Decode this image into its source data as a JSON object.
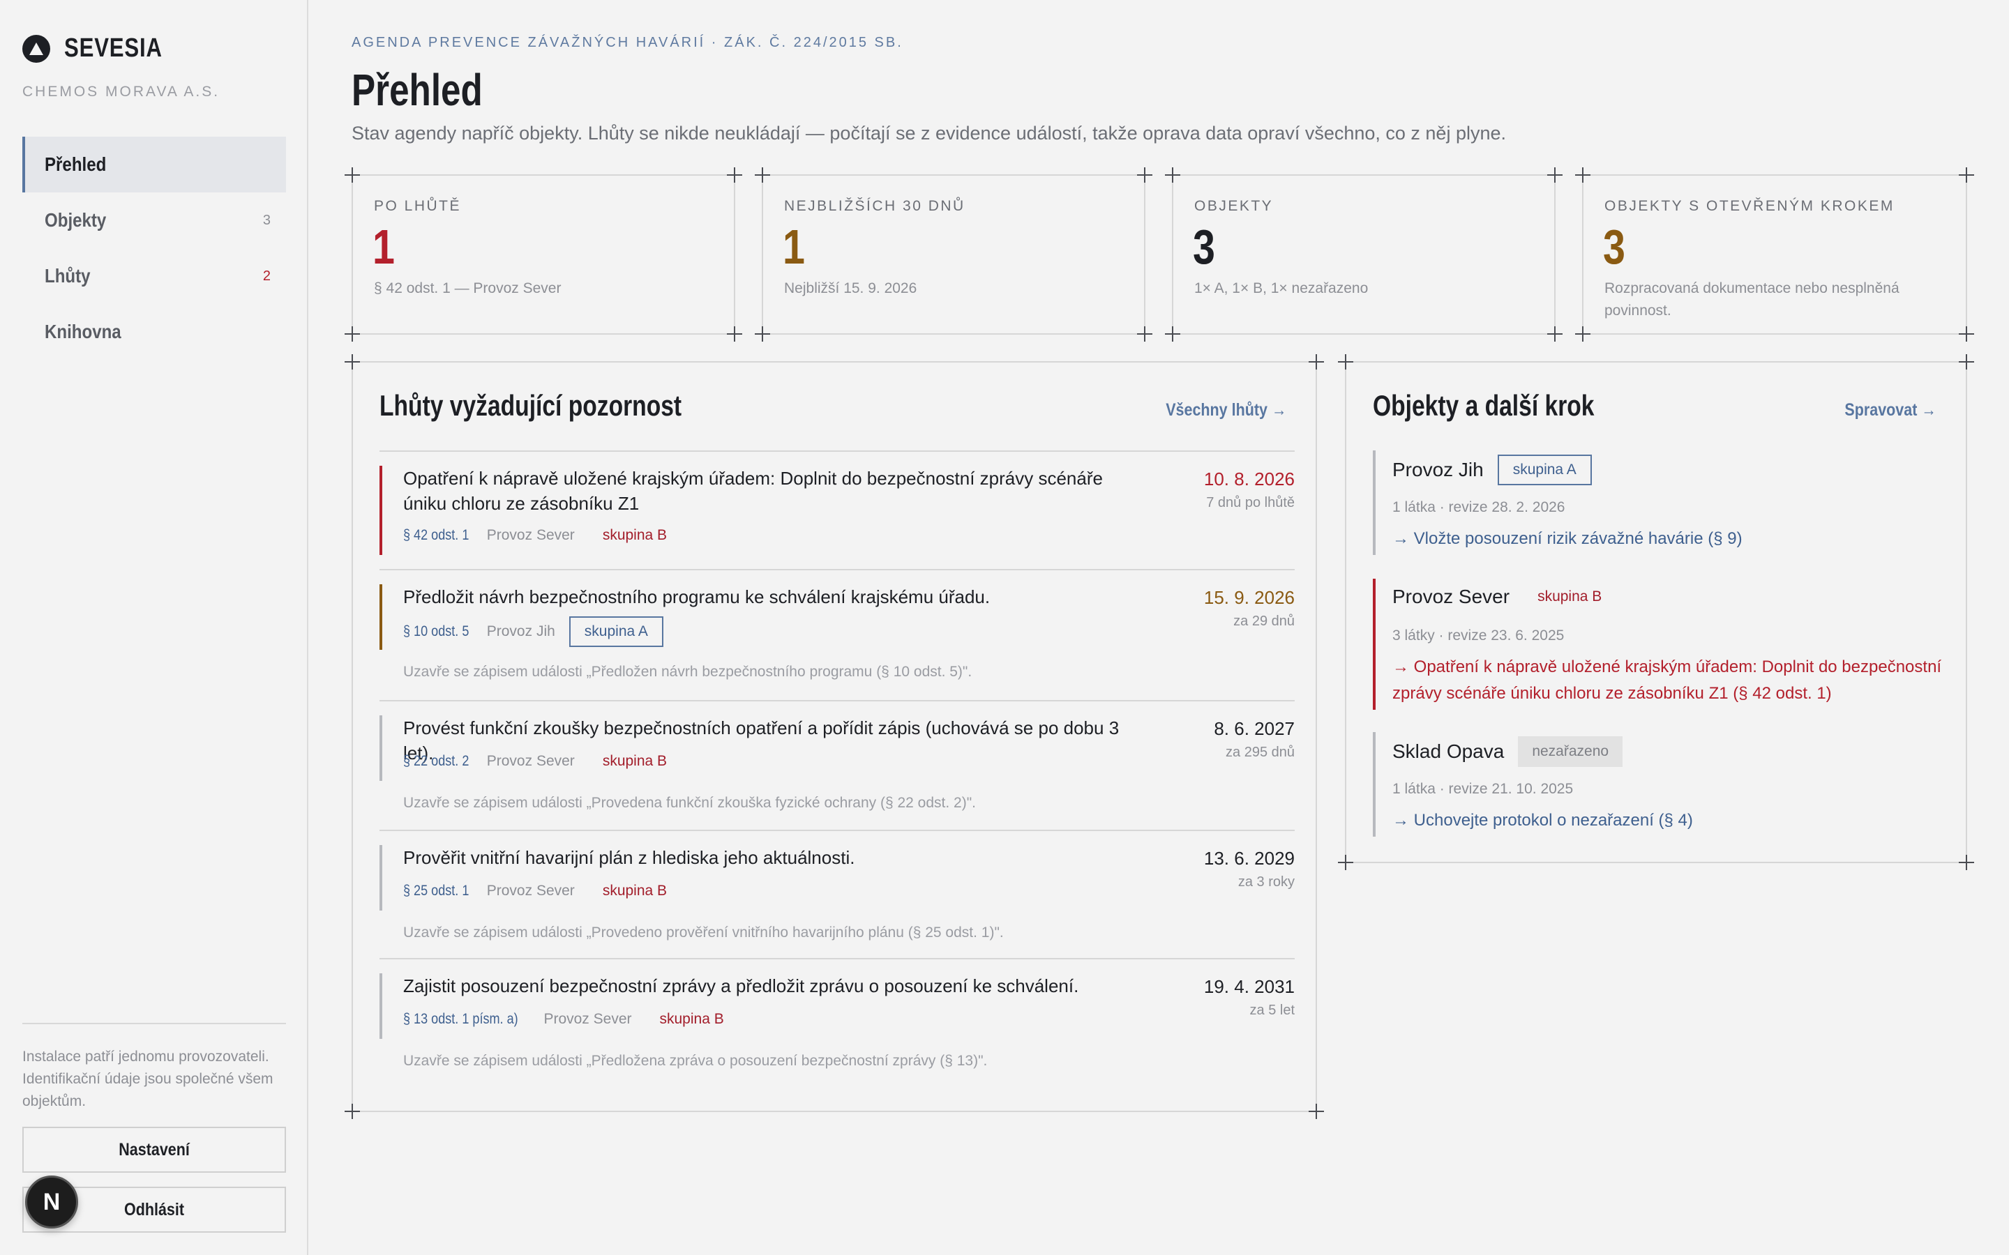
{
  "brand": {
    "name": "SEVESIA",
    "org": "CHEMOS MORAVA A.S."
  },
  "nav": [
    {
      "label": "Přehled",
      "count": ""
    },
    {
      "label": "Objekty",
      "count": "3"
    },
    {
      "label": "Lhůty",
      "count": "2"
    },
    {
      "label": "Knihovna",
      "count": ""
    }
  ],
  "sidebar_footer": {
    "note": "Instalace patří jednomu provozovateli. Identifikační údaje jsou společné všem objektům.",
    "settings_label": "Nastavení",
    "logout_label": "Odhlásit",
    "avatar_letter": "N"
  },
  "header": {
    "eyebrow": "AGENDA PREVENCE ZÁVAŽNÝCH HAVÁRIÍ · ZÁK. Č. 224/2015 SB.",
    "title": "Přehled",
    "subtitle": "Stav agendy napříč objekty. Lhůty se nikde neukládají — počítají se z evidence událostí, takže oprava data opraví všechno, co z něj plyne."
  },
  "stats": [
    {
      "label": "PO LHŮTĚ",
      "value": "1",
      "note": "§ 42 odst. 1 — Provoz Sever",
      "color": "#b3202c"
    },
    {
      "label": "NEJBLIŽŠÍCH 30 DNŮ",
      "value": "1",
      "note": "Nejbližší 15. 9. 2026",
      "color": "#8a5a12"
    },
    {
      "label": "OBJEKTY",
      "value": "3",
      "note": "1× A, 1× B, 1× nezařazeno",
      "color": "#1d1f24"
    },
    {
      "label": "OBJEKTY S OTEVŘENÝM KROKEM",
      "value": "3",
      "note": "Rozpracovaná dokumentace nebo nesplněná povinnost.",
      "color": "#8a5a12"
    }
  ],
  "deadlines": {
    "title": "Lhůty vyžadující pozornost",
    "link": "Všechny lhůty →",
    "items": [
      {
        "text": "Opatření k nápravě uložené krajským úřadem: Doplnit do bezpečnostní zprávy scénáře úniku chloru ze zásobníku Z1",
        "paragraph": "§ 42 odst. 1",
        "object": "Provoz Sever",
        "group": "skupina B",
        "date": "10. 8. 2026",
        "relative": "7 dnů po lhůtě",
        "close_note": "",
        "status": "overdue"
      },
      {
        "text": "Předložit návrh bezpečnostního programu ke schválení krajskému úřadu.",
        "paragraph": "§ 10 odst. 5",
        "object": "Provoz Jih",
        "group": "skupina A",
        "date": "15. 9. 2026",
        "relative": "za 29 dnů",
        "close_note": "Uzavře se zápisem události „Předložen návrh bezpečnostního programu (§ 10 odst. 5)\".",
        "status": "soon"
      },
      {
        "text": "Provést funkční zkoušky bezpečnostních opatření a pořídit zápis (uchovává se po dobu 3 let).",
        "paragraph": "§ 22 odst. 2",
        "object": "Provoz Sever",
        "group": "skupina B",
        "date": "8. 6. 2027",
        "relative": "za 295 dnů",
        "close_note": "Uzavře se zápisem události „Provedena funkční zkouška fyzické ochrany (§ 22 odst. 2)\".",
        "status": "normal"
      },
      {
        "text": "Prověřit vnitřní havarijní plán z hlediska jeho aktuálnosti.",
        "paragraph": "§ 25 odst. 1",
        "object": "Provoz Sever",
        "group": "skupina B",
        "date": "13. 6. 2029",
        "relative": "za 3 roky",
        "close_note": "Uzavře se zápisem události „Provedeno prověření vnitřního havarijního plánu (§ 25 odst. 1)\".",
        "status": "normal"
      },
      {
        "text": "Zajistit posouzení bezpečnostní zprávy a předložit zprávu o posouzení ke schválení.",
        "paragraph": "§ 13 odst. 1 písm. a)",
        "object": "Provoz Sever",
        "group": "skupina B",
        "date": "19. 4. 2031",
        "relative": "za 5 let",
        "close_note": "Uzavře se zápisem události „Předložena zpráva o posouzení bezpečnostní zprávy (§ 13)\".",
        "status": "normal"
      }
    ]
  },
  "objects": {
    "title": "Objekty a další krok",
    "link": "Spravovat →",
    "items": [
      {
        "name": "Provoz Jih",
        "group": "skupina A",
        "meta": "1 látka · revize 28. 2. 2026",
        "next": "→ Vložte posouzení rizik závažné havárie (§ 9)",
        "status": "normal"
      },
      {
        "name": "Provoz Sever",
        "group": "skupina B",
        "meta": "3 látky · revize 23. 6. 2025",
        "next": "→ Opatření k nápravě uložené krajským úřadem: Doplnit do bezpečnostní zprávy scénáře úniku chloru ze zásobníku Z1 (§ 42 odst. 1)",
        "status": "overdue"
      },
      {
        "name": "Sklad Opava",
        "group": "nezařazeno",
        "meta": "1 látka · revize 21. 10. 2025",
        "next": "→ Uchovejte protokol o nezařazení (§ 4)",
        "status": "normal"
      }
    ]
  },
  "colors": {
    "overdue": "#b3202c",
    "soon": "#8a5a12",
    "accent": "#5876a0",
    "neutral_bar": "#b7b9be"
  }
}
